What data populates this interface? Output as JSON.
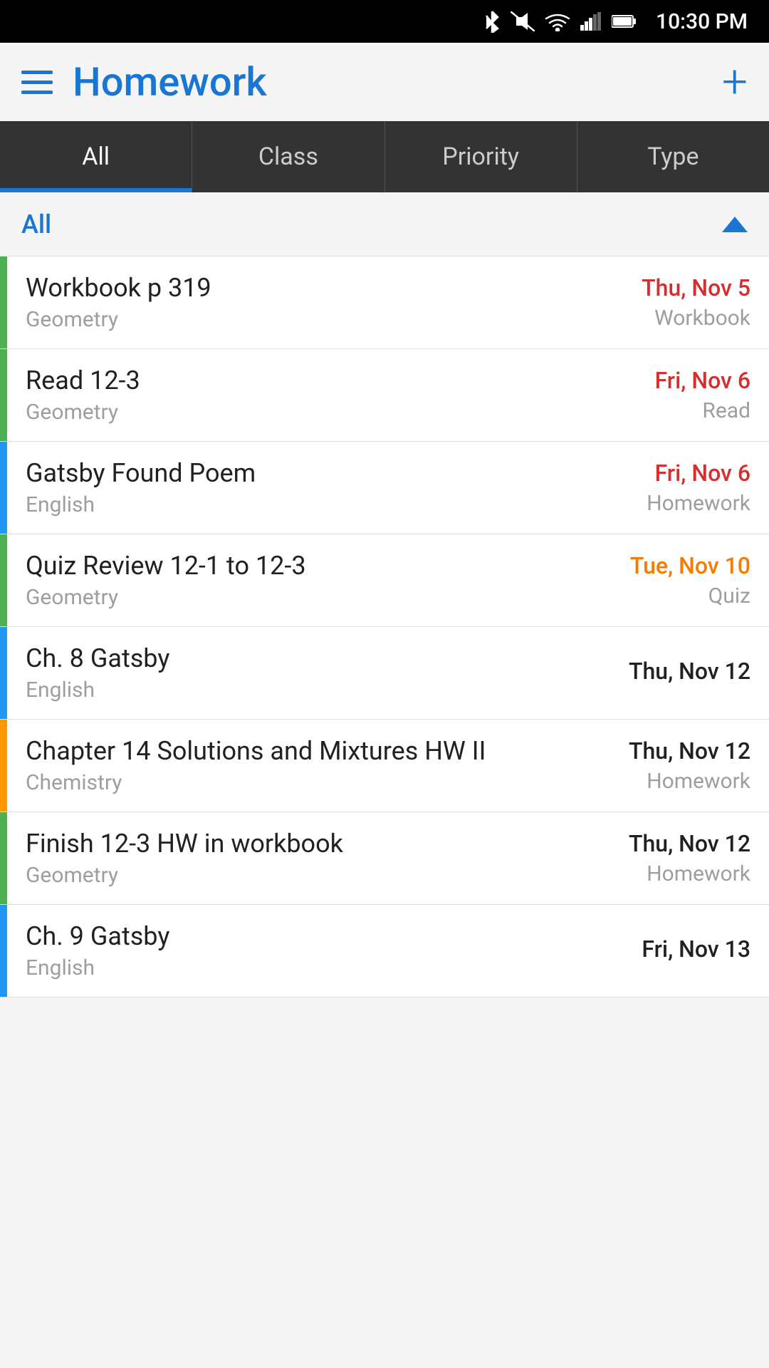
{
  "statusBar": {
    "time": "10:30 PM",
    "icons": [
      "bluetooth",
      "mute",
      "wifi-full",
      "wifi-partial",
      "signal",
      "battery"
    ]
  },
  "header": {
    "title": "Homework",
    "menuIcon": "menu-icon",
    "addIcon": "+"
  },
  "tabs": [
    {
      "id": "all",
      "label": "All",
      "active": true
    },
    {
      "id": "class",
      "label": "Class",
      "active": false
    },
    {
      "id": "priority",
      "label": "Priority",
      "active": false
    },
    {
      "id": "type",
      "label": "Type",
      "active": false
    }
  ],
  "filterRow": {
    "label": "All",
    "chevronIcon": "chevron-up-icon"
  },
  "assignments": [
    {
      "id": 1,
      "name": "Workbook p 319",
      "class": "Geometry",
      "date": "Thu, Nov 5",
      "dateClass": "date-red",
      "type": "Workbook",
      "colorClass": "color-green"
    },
    {
      "id": 2,
      "name": "Read 12-3",
      "class": "Geometry",
      "date": "Fri, Nov 6",
      "dateClass": "date-red",
      "type": "Read",
      "colorClass": "color-green"
    },
    {
      "id": 3,
      "name": "Gatsby Found Poem",
      "class": "English",
      "date": "Fri, Nov 6",
      "dateClass": "date-red",
      "type": "Homework",
      "colorClass": "color-blue"
    },
    {
      "id": 4,
      "name": "Quiz Review 12-1 to 12-3",
      "class": "Geometry",
      "date": "Tue, Nov 10",
      "dateClass": "date-orange",
      "type": "Quiz",
      "colorClass": "color-green"
    },
    {
      "id": 5,
      "name": "Ch. 8 Gatsby",
      "class": "English",
      "date": "Thu, Nov 12",
      "dateClass": "date-normal",
      "type": "",
      "colorClass": "color-blue"
    },
    {
      "id": 6,
      "name": "Chapter 14 Solutions and Mixtures HW II",
      "class": "Chemistry",
      "date": "Thu, Nov 12",
      "dateClass": "date-normal",
      "type": "Homework",
      "colorClass": "color-orange"
    },
    {
      "id": 7,
      "name": "Finish 12-3 HW in workbook",
      "class": "Geometry",
      "date": "Thu, Nov 12",
      "dateClass": "date-normal",
      "type": "Homework",
      "colorClass": "color-green"
    },
    {
      "id": 8,
      "name": "Ch. 9 Gatsby",
      "class": "English",
      "date": "Fri, Nov 13",
      "dateClass": "date-normal",
      "type": "",
      "colorClass": "color-blue"
    }
  ]
}
